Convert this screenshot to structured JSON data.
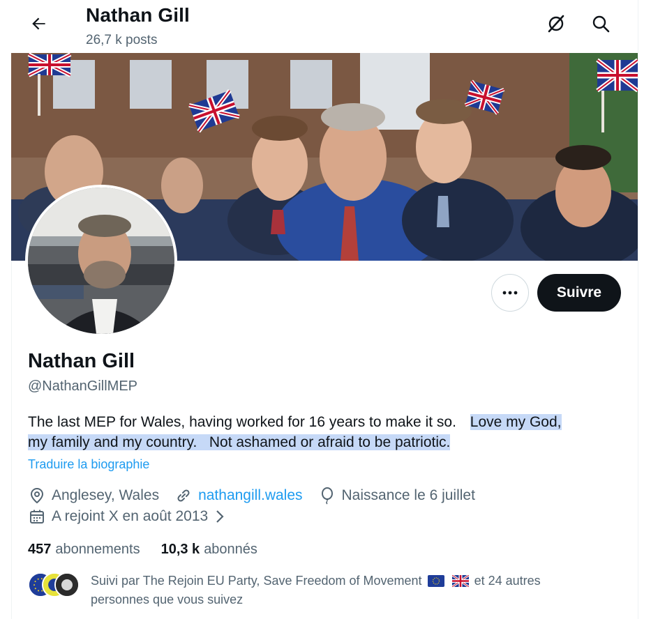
{
  "header": {
    "name": "Nathan Gill",
    "posts": "26,7 k posts"
  },
  "profile": {
    "display_name": "Nathan Gill",
    "handle": "@NathanGillMEP",
    "bio_plain": "The last MEP for Wales, having worked for 16 years to make it so.",
    "bio_highlight_1": "Love my God,",
    "bio_highlight_2": "my family and my country.   Not ashamed or afraid to be patriotic.",
    "translate_label": "Traduire la biographie",
    "follow_label": "Suivre"
  },
  "meta": {
    "location": "Anglesey, Wales",
    "website": "nathangill.wales",
    "birthday": "Naissance le 6 juillet",
    "joined": "A rejoint X en août 2013"
  },
  "stats": {
    "following_count": "457",
    "following_label": "abonnements",
    "followers_count": "10,3 k",
    "followers_label": "abonnés"
  },
  "followed_by": {
    "text_before": "Suivi par The Rejoin EU Party, Save Freedom of Movement",
    "text_after": "et 24 autres",
    "text_line2": "personnes que vous suivez"
  },
  "colors": {
    "accent": "#1d9bf0",
    "text_primary": "#0f1419",
    "text_secondary": "#536471",
    "highlight": "#c6d9f7",
    "follow_button": "#0f1419"
  },
  "icons": {
    "back": "arrow-left-icon",
    "grok": "grok-icon",
    "search": "search-icon",
    "more": "more-icon",
    "location": "location-pin-icon",
    "link": "link-icon",
    "birthday": "balloon-icon",
    "calendar": "calendar-icon",
    "chevron": "chevron-right-icon"
  }
}
